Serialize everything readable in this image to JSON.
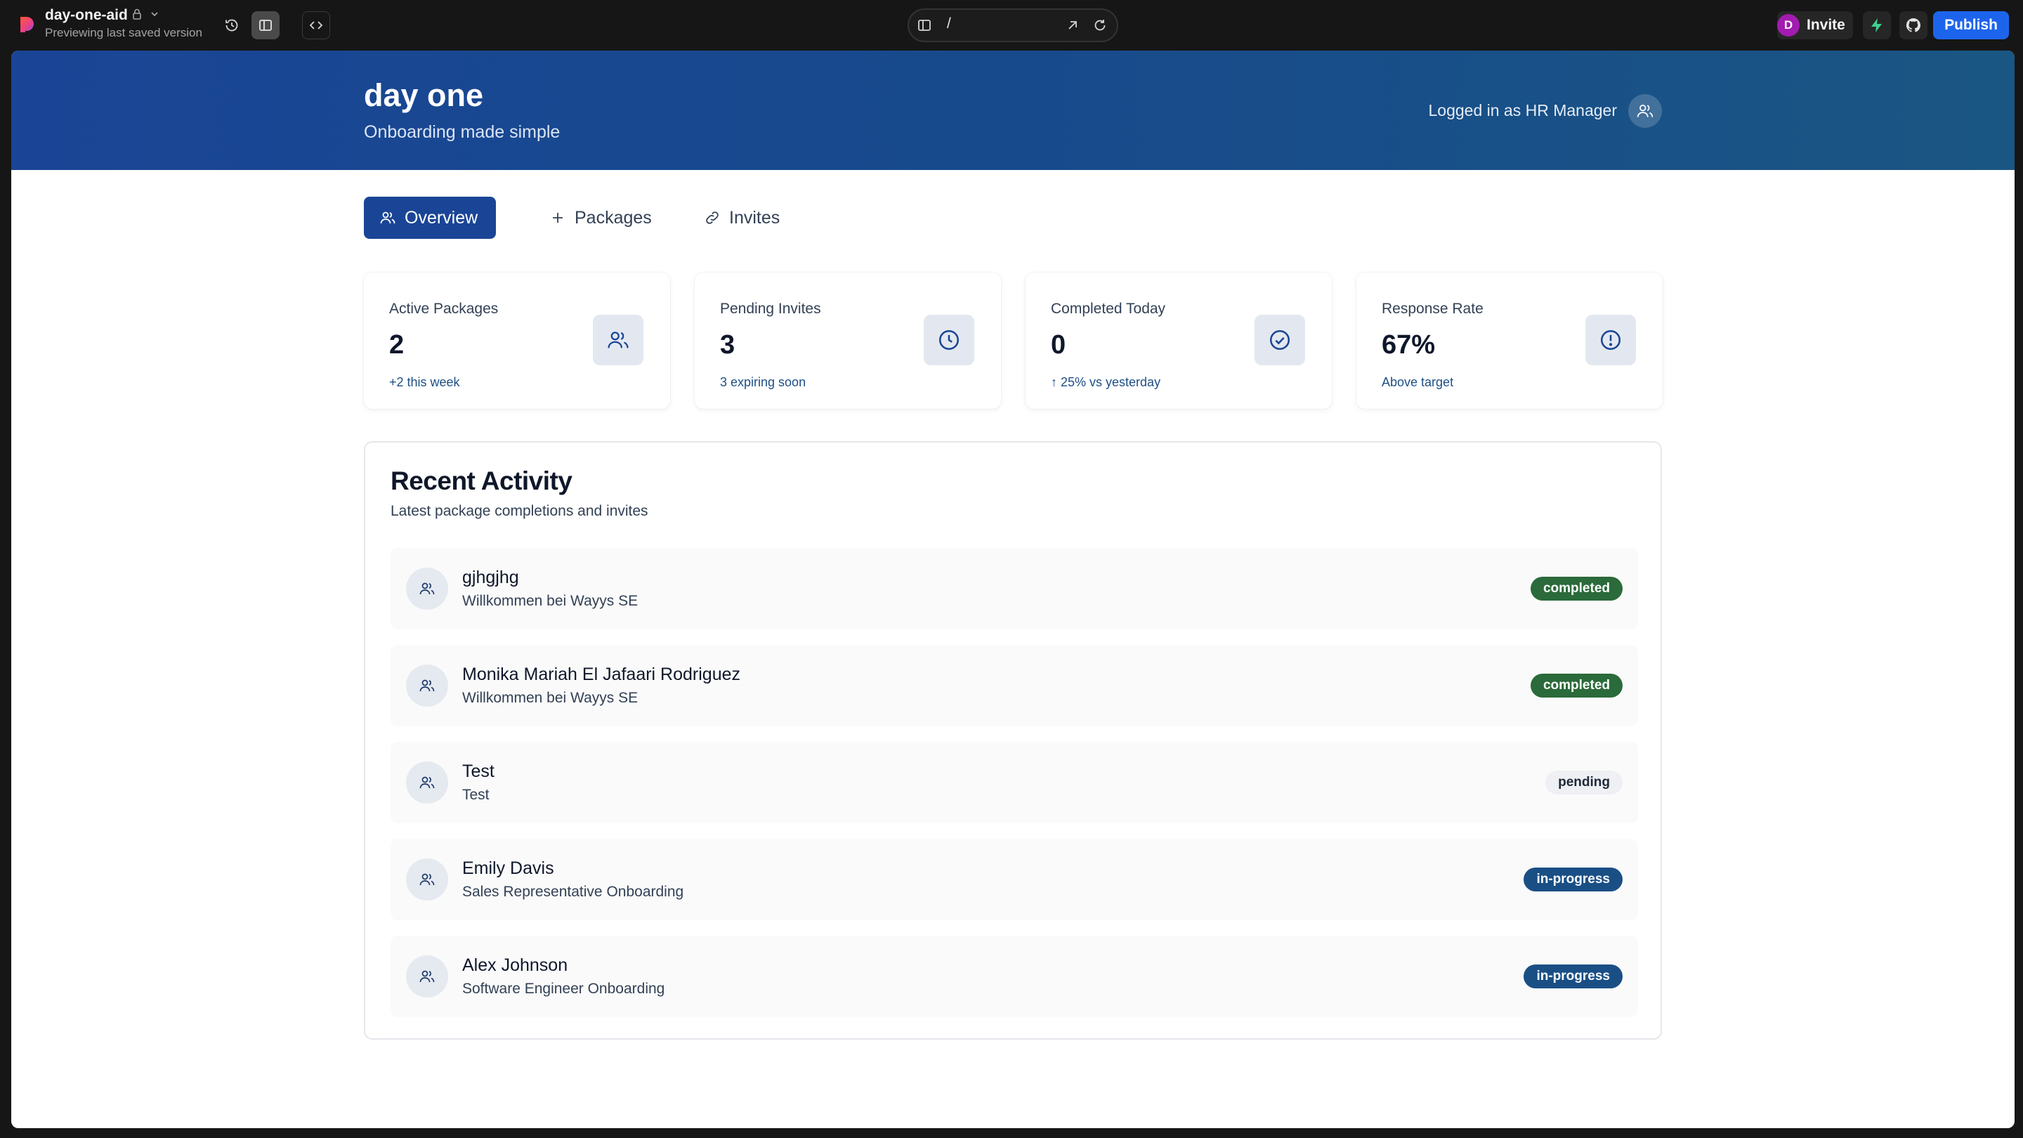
{
  "chrome": {
    "project_name": "day-one-aid",
    "project_status": "Previewing last saved version",
    "url_path": "/",
    "avatar_initial": "D",
    "invite_label": "Invite",
    "publish_label": "Publish"
  },
  "header": {
    "brand": "day one",
    "tagline": "Onboarding made simple",
    "logged_in_text": "Logged in as HR Manager"
  },
  "tabs": [
    {
      "label": "Overview",
      "active": true,
      "icon": "users-icon"
    },
    {
      "label": "Packages",
      "active": false,
      "icon": "plus-icon"
    },
    {
      "label": "Invites",
      "active": false,
      "icon": "link-icon"
    }
  ],
  "stats": [
    {
      "label": "Active Packages",
      "value": "2",
      "note": "+2 this week",
      "icon": "users-icon"
    },
    {
      "label": "Pending Invites",
      "value": "3",
      "note": "3 expiring soon",
      "icon": "clock-icon"
    },
    {
      "label": "Completed Today",
      "value": "0",
      "note": "↑ 25% vs yesterday",
      "icon": "check-circle-icon"
    },
    {
      "label": "Response Rate",
      "value": "67%",
      "note": "Above target",
      "icon": "alert-circle-icon"
    }
  ],
  "activity": {
    "title": "Recent Activity",
    "subtitle": "Latest package completions and invites",
    "items": [
      {
        "name": "gjhgjhg",
        "package": "Willkommen bei Wayys SE",
        "status": "completed"
      },
      {
        "name": "Monika Mariah El Jafaari Rodriguez",
        "package": "Willkommen bei Wayys SE",
        "status": "completed"
      },
      {
        "name": "Test",
        "package": "Test",
        "status": "pending"
      },
      {
        "name": "Emily Davis",
        "package": "Sales Representative Onboarding",
        "status": "in-progress"
      },
      {
        "name": "Alex Johnson",
        "package": "Software Engineer Onboarding",
        "status": "in-progress"
      }
    ]
  },
  "colors": {
    "header_gradient_start": "#1a4596",
    "header_gradient_end": "#1a5683",
    "active_tab": "#1a4596",
    "status_completed": "#2b6a3a",
    "status_pending": "#eef0f3",
    "status_in_progress": "#1a4f86",
    "publish_button": "#1d64ec"
  }
}
